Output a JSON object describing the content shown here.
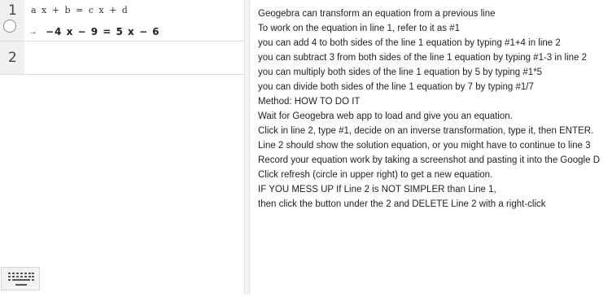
{
  "algebra": {
    "rows": [
      {
        "number": "1",
        "definition": "a x + b = c x + d",
        "arrow": "→",
        "output": "−4 x − 9 = 5 x − 6"
      },
      {
        "number": "2",
        "definition": "",
        "output": ""
      }
    ]
  },
  "keyboard": {
    "icon": "keyboard-icon"
  },
  "notes": [
    "Geogebra can transform an equation from a previous line",
    "To work on the equation in line 1, refer to it as #1",
    "you can add 4 to both sides of the line 1 equation by typing #1+4 in line 2",
    "you can subtract 3 from both sides of the line 1 equation by typing #1-3 in line 2",
    "you can multiply both sides of the line 1 equation by 5 by typing #1*5",
    "you can divide both sides of the line 1 equation by 7 by typing #1/7",
    "Method: HOW TO DO IT",
    "Wait for Geogebra web app to load and give you an equation.",
    "Click in line 2, type #1, decide on an inverse transformation, type it, then ENTER.",
    "Line 2 should show the solution equation, or you might have to continue to line 3",
    "Record your equation work by taking a screenshot and pasting it into the Google D",
    "Click refresh (circle in upper right) to get a new equation.",
    "IF YOU MESS UP If Line 2 is NOT SIMPLER than Line 1,",
    "then click the button under the 2 and DELETE Line 2 with a right-click"
  ]
}
